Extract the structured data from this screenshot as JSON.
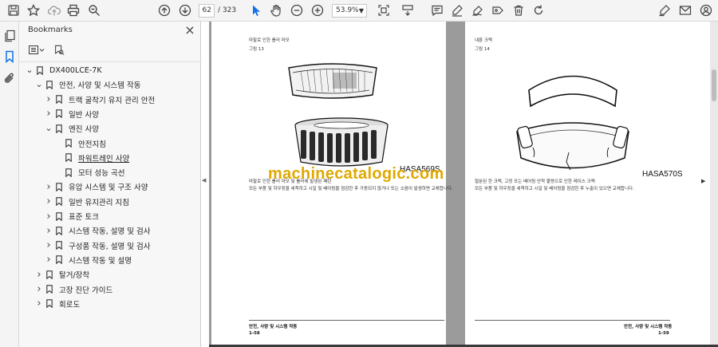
{
  "toolbar": {
    "page_current": "62",
    "page_total": "/ 323",
    "zoom": "53.9%"
  },
  "panel": {
    "title": "Bookmarks",
    "close": "×"
  },
  "bookmarks": [
    {
      "label": "DX400LCE-7K",
      "state": "expanded"
    },
    {
      "label": "안전, 사양 및 시스템 작동",
      "state": "expanded"
    },
    {
      "label": "트랙 굴착기 유지 관리 안전",
      "state": "collapsed"
    },
    {
      "label": "일반 사양",
      "state": "collapsed"
    },
    {
      "label": "엔진 사양",
      "state": "expanded"
    },
    {
      "label": "안전지침",
      "state": "leaf"
    },
    {
      "label": "파워트레인 사양",
      "state": "leaf",
      "current": true
    },
    {
      "label": "모터 성능 곡선",
      "state": "leaf"
    },
    {
      "label": "유압 시스템 및 구조 사양",
      "state": "collapsed"
    },
    {
      "label": "일반 유지관리 지침",
      "state": "collapsed"
    },
    {
      "label": "표준 토크",
      "state": "collapsed"
    },
    {
      "label": "시스템 작동, 설명 및 검사",
      "state": "collapsed"
    },
    {
      "label": "구성품 작동, 설명 및 검사",
      "state": "collapsed"
    },
    {
      "label": "시스템 작동 및 설명",
      "state": "collapsed"
    },
    {
      "label": "탈거/장착",
      "state": "collapsed"
    },
    {
      "label": "고장 진단 가이드",
      "state": "collapsed"
    },
    {
      "label": "회로도",
      "state": "collapsed"
    }
  ],
  "doc": {
    "left_page": {
      "heading": "마찰로 인한 롤러 마모",
      "figure": "그림 13",
      "caption": "HASA569S",
      "body_1": "마찰로 인한 롤러 마모 및 롤러에 발생된 패턴",
      "body_2": "모든 부품 및 하우징을 세척하고 시일 및 베어링을 점검한 후 가동되지 않거나 또는 소음이 발생하면 교체합니다.",
      "footer_title": "안전, 사양 및 시스템 작동",
      "footer_page": "1-58"
    },
    "right_page": {
      "heading": "내륜 크랙",
      "figure": "그림 14",
      "caption": "HASA570S",
      "body_1": "철분된 한 크랙, 고정 또는 베어링 안착 불량으로 인한 레이스 크랙",
      "body_2": "모든 부품 및 하우징을 세척하고 시일 및 베어링을 점검한 후 누출이 있으면 교체합니다.",
      "footer_title": "안전, 사양 및 시스템 작동",
      "footer_page": "1-59"
    },
    "watermark": "machinecatalogic.com"
  }
}
